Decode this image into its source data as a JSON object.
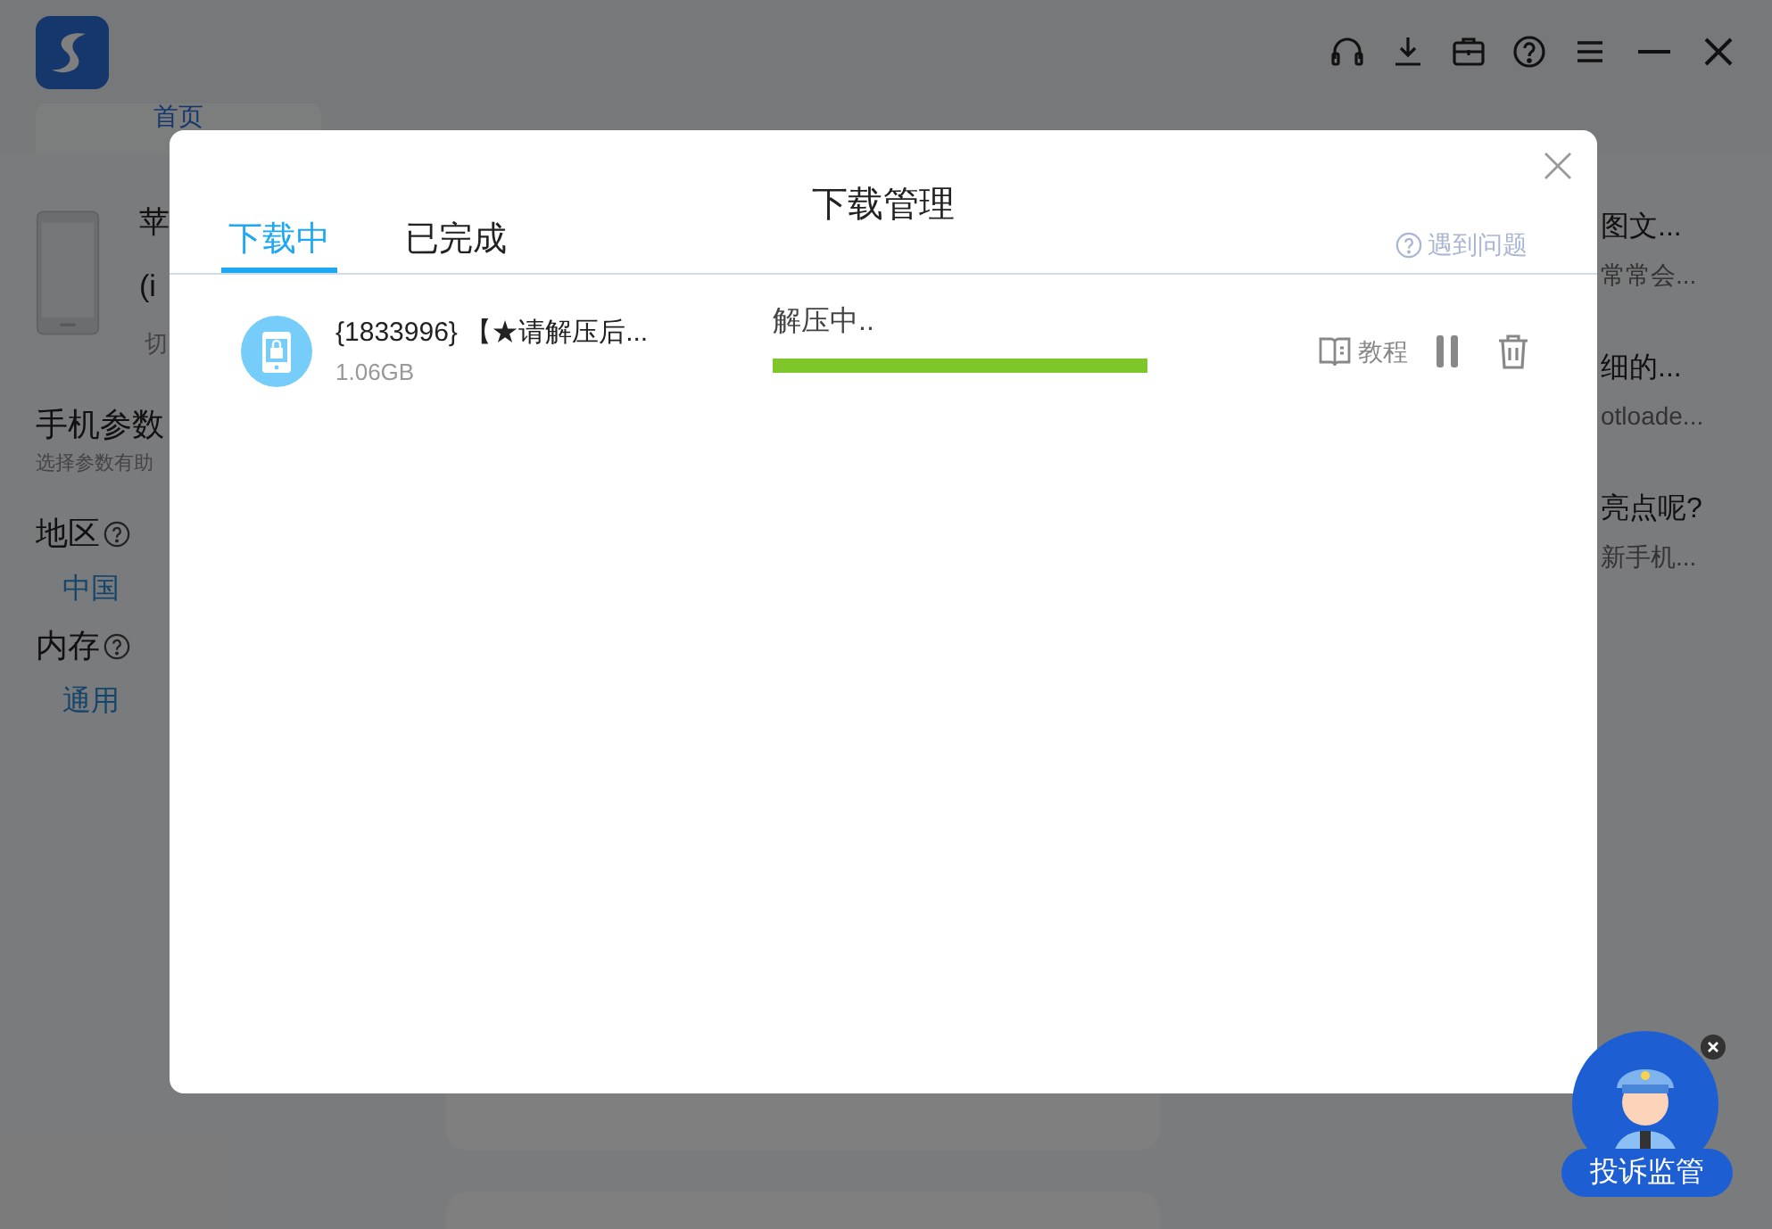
{
  "app": {
    "home_tab": "首页",
    "device": {
      "name": "苹",
      "model": "(i",
      "switch": "切"
    },
    "params": {
      "title": "手机参数",
      "hint": "选择参数有助",
      "fields": [
        {
          "label": "地区",
          "value": "中国"
        },
        {
          "label": "内存",
          "value": "通用"
        }
      ]
    },
    "articles": [
      {
        "title": "图文...",
        "summary": "常常会..."
      },
      {
        "title": "细的...",
        "summary": "otloade..."
      },
      {
        "title": "亮点呢?",
        "summary": "新手机..."
      }
    ]
  },
  "dialog": {
    "title": "下载管理",
    "tabs": [
      {
        "label": "下载中",
        "selected": true
      },
      {
        "label": "已完成",
        "selected": false
      }
    ],
    "help": "遇到问题",
    "downloads": [
      {
        "name": "{1833996} 【★请解压后...",
        "size": "1.06GB",
        "status": "解压中..",
        "level": 1,
        "tutorial": "教程"
      }
    ]
  },
  "complaint_badge": {
    "label": "投诉监管"
  }
}
